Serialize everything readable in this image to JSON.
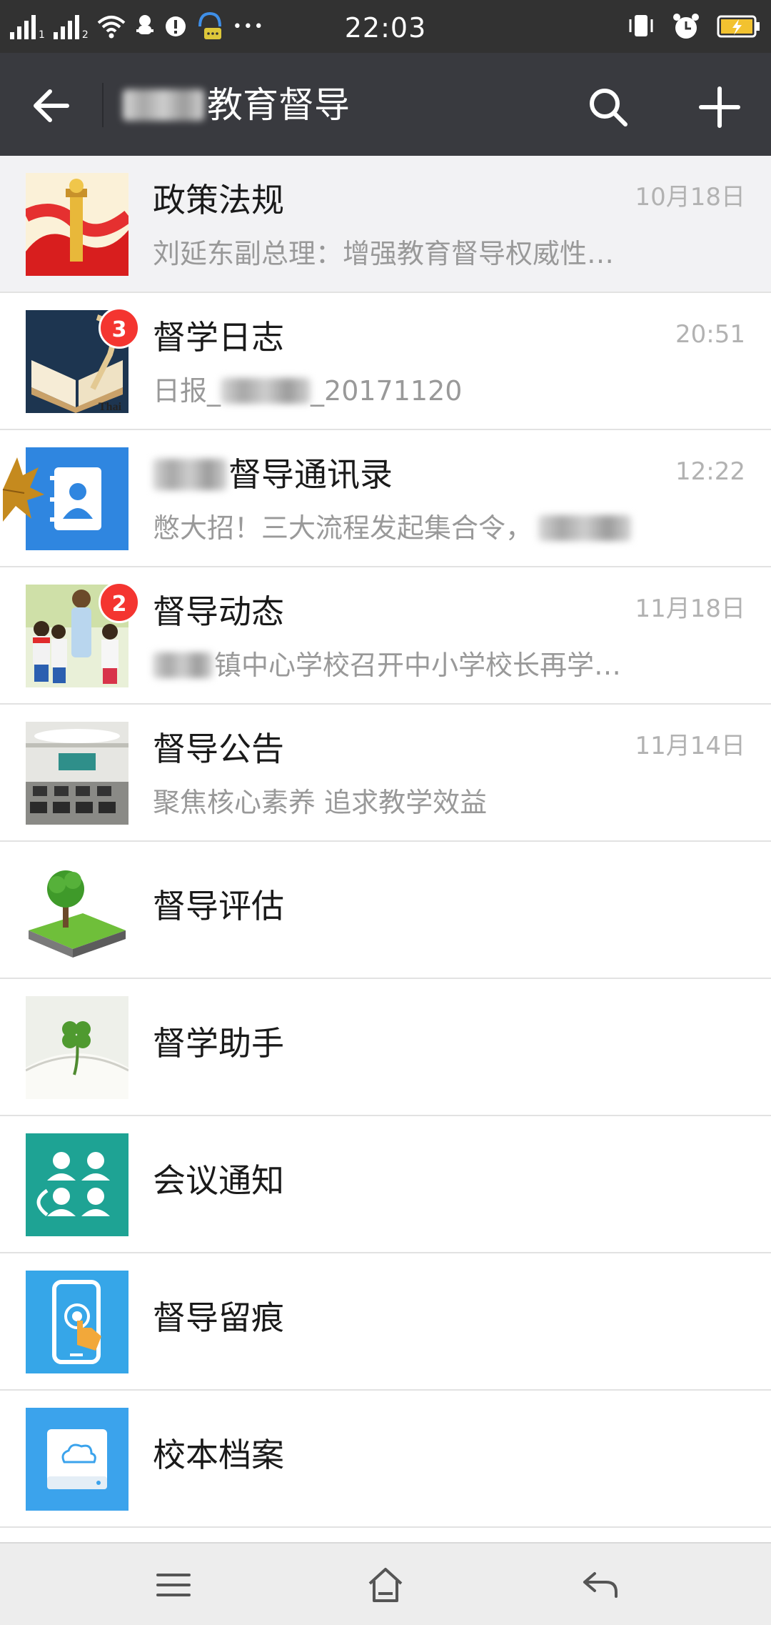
{
  "status_bar": {
    "time": "22:03",
    "sim1": "1",
    "sim2": "2",
    "more": "•••",
    "icons": [
      "signal-icon",
      "wifi-icon",
      "notification-icon",
      "alert-icon",
      "headset-chat-icon",
      "vibrate-icon",
      "alarm-icon",
      "battery-charging-icon"
    ]
  },
  "header": {
    "title": "教育督导",
    "back_icon": "arrow-left-icon",
    "search_icon": "search-icon",
    "add_icon": "plus-icon",
    "colors": {
      "bar": "#393a3f",
      "status": "#323232"
    }
  },
  "chats": [
    {
      "title": "政策法规",
      "time": "10月18日",
      "preview": "刘延东副总理：增强教育督导权威性…",
      "icon": "emblem-avatar"
    },
    {
      "title": "督学日志",
      "time": "20:51",
      "badge": "3",
      "preview_prefix": "日报_",
      "preview_suffix": "_20171120",
      "icon": "book-quill-avatar",
      "avatar_text": "Thai"
    },
    {
      "title": "督导通讯录",
      "time": "12:22",
      "preview": "憋大招！三大流程发起集合令，",
      "icon": "contacts-book-avatar"
    },
    {
      "title": "督导动态",
      "time": "11月18日",
      "badge": "2",
      "preview": "镇中心学校召开中小学校长再学…",
      "icon": "students-photo-avatar"
    },
    {
      "title": "督导公告",
      "time": "11月14日",
      "preview": "聚焦核心素养 追求教学效益",
      "icon": "meeting-room-avatar"
    },
    {
      "title": "督导评估",
      "icon": "tree-avatar"
    },
    {
      "title": "督学助手",
      "icon": "clover-book-avatar"
    },
    {
      "title": "会议通知",
      "icon": "people-group-avatar"
    },
    {
      "title": "督导留痕",
      "icon": "touch-phone-avatar"
    },
    {
      "title": "校本档案",
      "icon": "cloud-drive-avatar"
    }
  ],
  "bottom_nav": {
    "icons": [
      "menu-icon",
      "home-icon",
      "back-icon"
    ]
  }
}
